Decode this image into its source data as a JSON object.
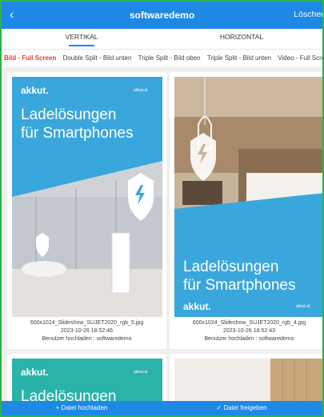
{
  "header": {
    "back_icon": "chevron-left-icon",
    "title": "softwaredemo",
    "delete_label": "Löschen"
  },
  "tabs": [
    {
      "label": "VERTIKAL",
      "active": true
    },
    {
      "label": "HORIZONTAL",
      "active": false
    }
  ],
  "subtabs": [
    {
      "label": "Bild - Full Screen",
      "active": true
    },
    {
      "label": "Double Split - Bild unten",
      "active": false
    },
    {
      "label": "Triple Split - Bild oben",
      "active": false
    },
    {
      "label": "Triple Split - Bild unten",
      "active": false
    },
    {
      "label": "Video - Full Screen und Sp",
      "active": false
    }
  ],
  "cards": [
    {
      "filename": "600x1024_Slideshow_SUJET2020_rgb_5.jpg",
      "date": "2023-10-26 18:52:46",
      "uploader": "Benutzer hochladen : softwaredemo",
      "logo": "akkut.",
      "site": "akkut.at",
      "headline": [
        "Ladelösungen",
        "für Smartphones"
      ]
    },
    {
      "filename": "600x1024_Slideshow_SUJET2020_rgb_4.jpg",
      "date": "2023-10-26 18:52:43",
      "uploader": "Benutzer hochladen : softwaredemo",
      "logo": "akkut.",
      "site": "akkut.at",
      "headline": [
        "Ladelösungen",
        "für Smartphones"
      ]
    },
    {
      "logo": "akkut.",
      "site": "akkut.at",
      "headline": [
        "Ladelösungen"
      ]
    }
  ],
  "bottom": {
    "upload_label": "+ Datei hochladen",
    "share_label": "✓ Datei freigeben"
  },
  "colors": {
    "primary": "#1e88e5",
    "active_subtab": "#e53935",
    "teal": "#2ab3a8",
    "sky": "#3aa7dc"
  }
}
